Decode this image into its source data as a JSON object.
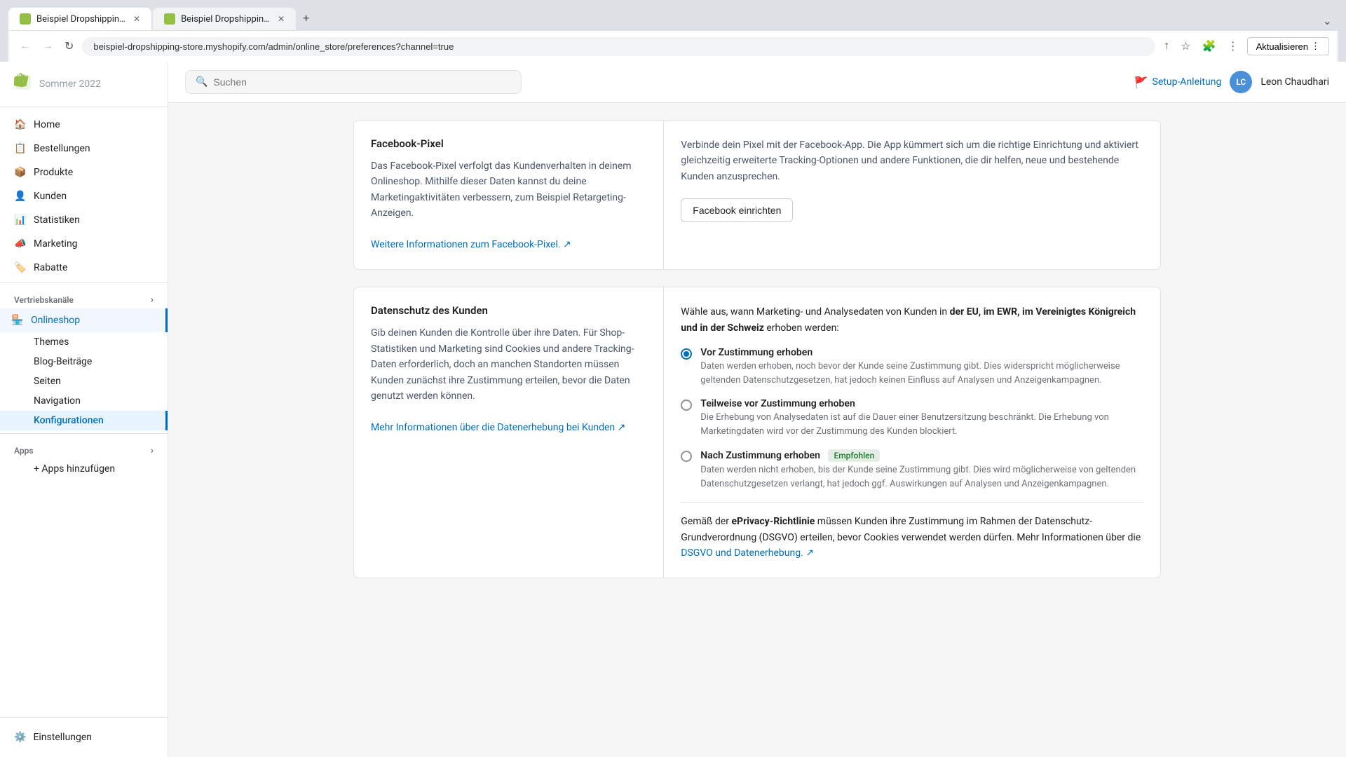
{
  "browser": {
    "tabs": [
      {
        "id": "tab1",
        "label": "Beispiel Dropshipping Store ·...",
        "active": true,
        "favicon": "S"
      },
      {
        "id": "tab2",
        "label": "Beispiel Dropshipping Store",
        "active": false,
        "favicon": "S"
      }
    ],
    "address": "beispiel-dropshipping-store.myshopify.com/admin/online_store/preferences?channel=true",
    "update_btn": "Aktualisieren"
  },
  "topbar": {
    "search_placeholder": "Suchen",
    "setup_label": "Setup-Anleitung",
    "user_initials": "LC",
    "user_name": "Leon Chaudhari"
  },
  "sidebar": {
    "logo_text": "Sommer 2022",
    "items": [
      {
        "id": "home",
        "label": "Home",
        "icon": "house"
      },
      {
        "id": "bestellungen",
        "label": "Bestellungen",
        "icon": "orders"
      },
      {
        "id": "produkte",
        "label": "Produkte",
        "icon": "products"
      },
      {
        "id": "kunden",
        "label": "Kunden",
        "icon": "customers"
      },
      {
        "id": "statistiken",
        "label": "Statistiken",
        "icon": "stats"
      },
      {
        "id": "marketing",
        "label": "Marketing",
        "icon": "marketing"
      },
      {
        "id": "rabatte",
        "label": "Rabatte",
        "icon": "rabatte"
      }
    ],
    "vertriebskanaele_label": "Vertriebskanäle",
    "vertriebskanaele_arrow": "›",
    "sub_items": [
      {
        "id": "onlineshop",
        "label": "Onlineshop",
        "active": true
      },
      {
        "id": "themes",
        "label": "Themes",
        "active": false
      },
      {
        "id": "blog_beitraege",
        "label": "Blog-Beiträge",
        "active": false
      },
      {
        "id": "seiten",
        "label": "Seiten",
        "active": false
      },
      {
        "id": "navigation",
        "label": "Navigation",
        "active": false
      },
      {
        "id": "konfigurationen",
        "label": "Konfigurationen",
        "active": false,
        "selected": true
      }
    ],
    "apps_label": "Apps",
    "apps_arrow": "›",
    "add_apps_label": "+ Apps hinzufügen",
    "settings_label": "Einstellungen"
  },
  "facebook_section": {
    "title": "Facebook-Pixel",
    "description": "Das Facebook-Pixel verfolgt das Kundenverhalten in deinem Onlineshop. Mithilfe dieser Daten kannst du deine Marketingaktivitäten verbessern, zum Beispiel Retargeting-Anzeigen.",
    "link_text": "Weitere Informationen zum Facebook-Pixel.",
    "link_icon": "↗",
    "right_text": "Verbinde dein Pixel mit der Facebook-App. Die App kümmert sich um die richtige Einrichtung und aktiviert gleichzeitig erweiterte Tracking-Optionen und andere Funktionen, die dir helfen, neue und bestehende Kunden anzusprechen.",
    "button_label": "Facebook einrichten"
  },
  "datenschutz_section": {
    "title": "Datenschutz des Kunden",
    "description_1": "Gib deinen Kunden die Kontrolle über ihre Daten. Für Shop-Statistiken und Marketing sind Cookies und andere Tracking-Daten erforderlich, doch an manchen Standorten müssen Kunden zunächst ihre Zustimmung erteilen, bevor die Daten genutzt werden können.",
    "link_text": "Mehr Informationen über die Datenerhebung bei Kunden",
    "link_icon": "↗",
    "right_title": "Wähle aus, wann Marketing- und Analysedaten von Kunden in",
    "right_title_bold": "der EU, im EWR, im Vereinigtes Königreich und in der Schweiz",
    "right_title_end": "erhoben werden:",
    "options": [
      {
        "id": "vor_zustimmung",
        "label": "Vor Zustimmung erhoben",
        "checked": true,
        "description": "Daten werden erhoben, noch bevor der Kunde seine Zustimmung gibt. Dies widerspricht möglicherweise geltenden Datenschutzgesetzen, hat jedoch keinen Einfluss auf Analysen und Anzeigenkampagnen."
      },
      {
        "id": "teilweise",
        "label": "Teilweise vor Zustimmung erhoben",
        "checked": false,
        "description": "Die Erhebung von Analysedaten ist auf die Dauer einer Benutzersitzung beschränkt. Die Erhebung von Marketingdaten wird vor der Zustimmung des Kunden blockiert."
      },
      {
        "id": "nach_zustimmung",
        "label": "Nach Zustimmung erhoben",
        "badge": "Empfohlen",
        "checked": false,
        "description": "Daten werden nicht erhoben, bis der Kunde seine Zustimmung gibt. Dies wird möglicherweise von geltenden Datenschutzgesetzen verlangt, hat jedoch ggf. Auswirkungen auf Analysen und Anzeigenkampagnen."
      }
    ],
    "info_text_1": "Gemäß der ",
    "info_bold": "ePrivacy-Richtlinie",
    "info_text_2": " müssen Kunden ihre Zustimmung im Rahmen der Datenschutz-Grundverordnung (DSGVO) erteilen, bevor Cookies verwendet werden dürfen. Mehr Informationen über die ",
    "info_link": "DSGVO und Datenerhebung.",
    "info_link_icon": "↗"
  }
}
